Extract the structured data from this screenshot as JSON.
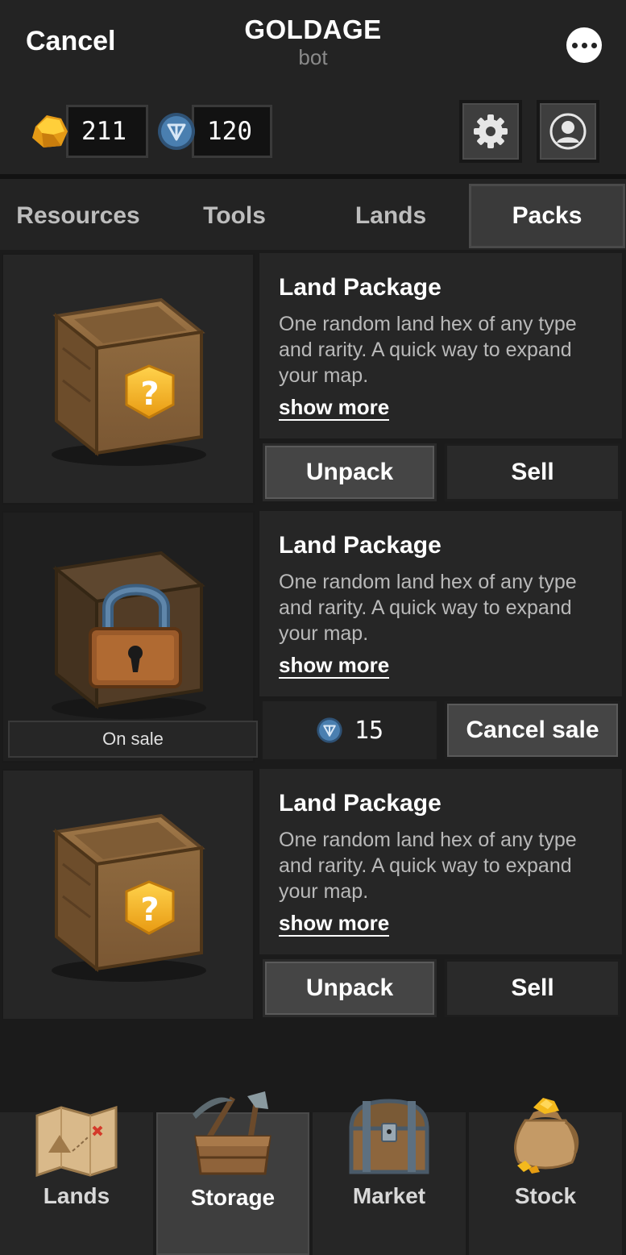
{
  "header": {
    "cancel_label": "Cancel",
    "title": "GOLDAGE",
    "subtitle": "bot"
  },
  "resources": {
    "gold": "211",
    "ton": "120"
  },
  "tabs": [
    {
      "label": "Resources",
      "active": false
    },
    {
      "label": "Tools",
      "active": false
    },
    {
      "label": "Lands",
      "active": false
    },
    {
      "label": "Packs",
      "active": true
    }
  ],
  "packs": [
    {
      "name": "Land Package",
      "description": "One random land hex of any type and rarity. A quick way to expand your map.",
      "show_more": "show more",
      "primary_action": "Unpack",
      "secondary_action": "Sell",
      "state": "owned"
    },
    {
      "name": "Land Package",
      "description": "One random land hex of any type and rarity. A quick way to expand your map.",
      "show_more": "show more",
      "status_label": "On sale",
      "price": "15",
      "secondary_action": "Cancel sale",
      "state": "on_sale"
    },
    {
      "name": "Land Package",
      "description": "One random land hex of any type and rarity. A quick way to expand your map.",
      "show_more": "show more",
      "primary_action": "Unpack",
      "secondary_action": "Sell",
      "state": "owned"
    }
  ],
  "bottom_nav": [
    {
      "label": "Lands",
      "icon": "map-icon",
      "active": false
    },
    {
      "label": "Storage",
      "icon": "toolbox-icon",
      "active": true
    },
    {
      "label": "Market",
      "icon": "chest-icon",
      "active": false
    },
    {
      "label": "Stock",
      "icon": "gold-bag-icon",
      "active": false
    }
  ],
  "colors": {
    "background": "#1b1b1b",
    "panel": "#262626",
    "gold": "#f2b51f",
    "ton_coin": "#3d6a94"
  }
}
